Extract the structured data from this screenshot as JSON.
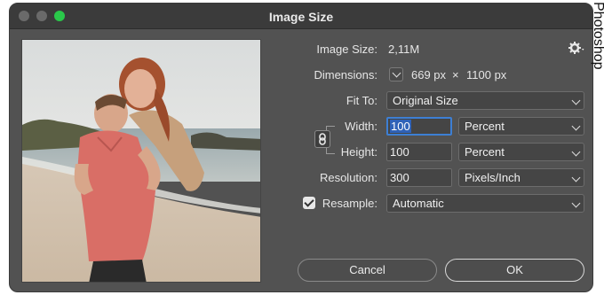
{
  "window": {
    "title": "Image Size"
  },
  "image_size": {
    "label": "Image Size:",
    "value": "2,11M"
  },
  "dimensions": {
    "label": "Dimensions:",
    "width": "669 px",
    "times": "×",
    "height": "1100 px"
  },
  "fit_to": {
    "label": "Fit To:",
    "value": "Original Size"
  },
  "width": {
    "label": "Width:",
    "value": "100",
    "unit": "Percent"
  },
  "height": {
    "label": "Height:",
    "value": "100",
    "unit": "Percent"
  },
  "resolution": {
    "label": "Resolution:",
    "value": "300",
    "unit": "Pixels/Inch"
  },
  "resample": {
    "label": "Resample:",
    "value": "Automatic",
    "checked": true
  },
  "buttons": {
    "cancel": "Cancel",
    "ok": "OK"
  },
  "side_text": "Photoshop",
  "colors": {
    "close_dot": "#6a6a6a",
    "min_dot": "#6a6a6a",
    "max_dot": "#2ac84a",
    "accent": "#3d7fd4"
  },
  "icons": [
    "gear-icon",
    "chain-link-icon",
    "chevron-down-icon"
  ]
}
